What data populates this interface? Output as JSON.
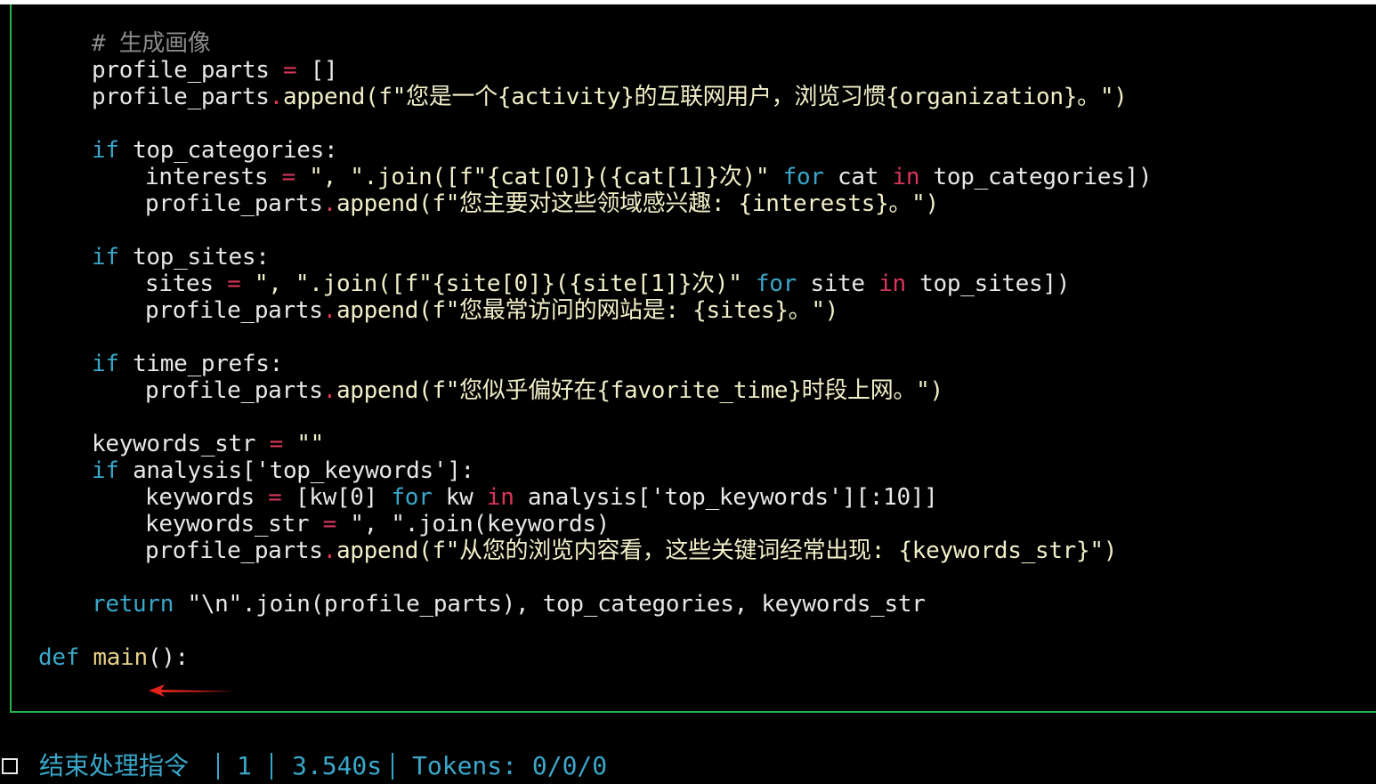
{
  "code": {
    "l1": "# 生成画像",
    "l2_a": "profile_parts",
    "l2_b": " = ",
    "l2_c": "[]",
    "l3_a": "profile_parts",
    "l3_b": ".",
    "l3_c": "append(f\"您是一个{activity}的互联网用户，浏览习惯{organization}。\")",
    "l5_kw": "if",
    "l5_rest": " top_categories:",
    "l6_a": "interests",
    "l6_b": " = ",
    "l6_c": "\", \".join([f\"{cat[0]}({cat[1]}次)\"",
    "l6_for": " for",
    "l6_d": " cat ",
    "l6_in": "in",
    "l6_e": " top_categories])",
    "l7_a": "profile_parts",
    "l7_b": ".",
    "l7_c": "append(f\"您主要对这些领域感兴趣: {interests}。\")",
    "l9_kw": "if",
    "l9_rest": " top_sites:",
    "l10_a": "sites",
    "l10_b": " = ",
    "l10_c": "\", \".join([f\"{site[0]}({site[1]}次)\"",
    "l10_for": " for",
    "l10_d": " site ",
    "l10_in": "in",
    "l10_e": " top_sites])",
    "l11_a": "profile_parts",
    "l11_b": ".",
    "l11_c": "append(f\"您最常访问的网站是: {sites}。\")",
    "l13_kw": "if",
    "l13_rest": " time_prefs:",
    "l14_a": "profile_parts",
    "l14_b": ".",
    "l14_c": "append(f\"您似乎偏好在{favorite_time}时段上网。\")",
    "l16_a": "keywords_str",
    "l16_b": " = ",
    "l16_c": "\"\"",
    "l17_kw": "if",
    "l17_rest": " analysis['top_keywords']:",
    "l18_a": "keywords",
    "l18_b": " = ",
    "l18_c": "[kw[0] ",
    "l18_for": "for",
    "l18_d": " kw ",
    "l18_in": "in",
    "l18_e": " analysis['top_keywords'][:10]]",
    "l19_a": "keywords_str",
    "l19_b": " = ",
    "l19_c": "\", \".join(keywords)",
    "l20_a": "profile_parts",
    "l20_b": ".",
    "l20_c": "append(f\"从您的浏览内容看，这些关键词经常出现: {keywords_str}\")",
    "l22_kw": "return",
    "l22_rest": " \"\\n\".join(profile_parts), top_categories, keywords_str",
    "l24_kw": "def",
    "l24_name": " main",
    "l24_rest": "():"
  },
  "status_bar": {
    "command_label": "结束处理指令",
    "count": "1",
    "elapsed": "3.540s",
    "tokens": "Tokens: 0/0/0"
  },
  "colors": {
    "background": "#000000",
    "frame_border": "#23b24a",
    "keyword": "#3aa7c9",
    "operator": "#d8365a",
    "arrow": "#e0241c"
  },
  "icons": {
    "arrow": "red-left-arrow",
    "checkbox": "checkbox-icon"
  }
}
